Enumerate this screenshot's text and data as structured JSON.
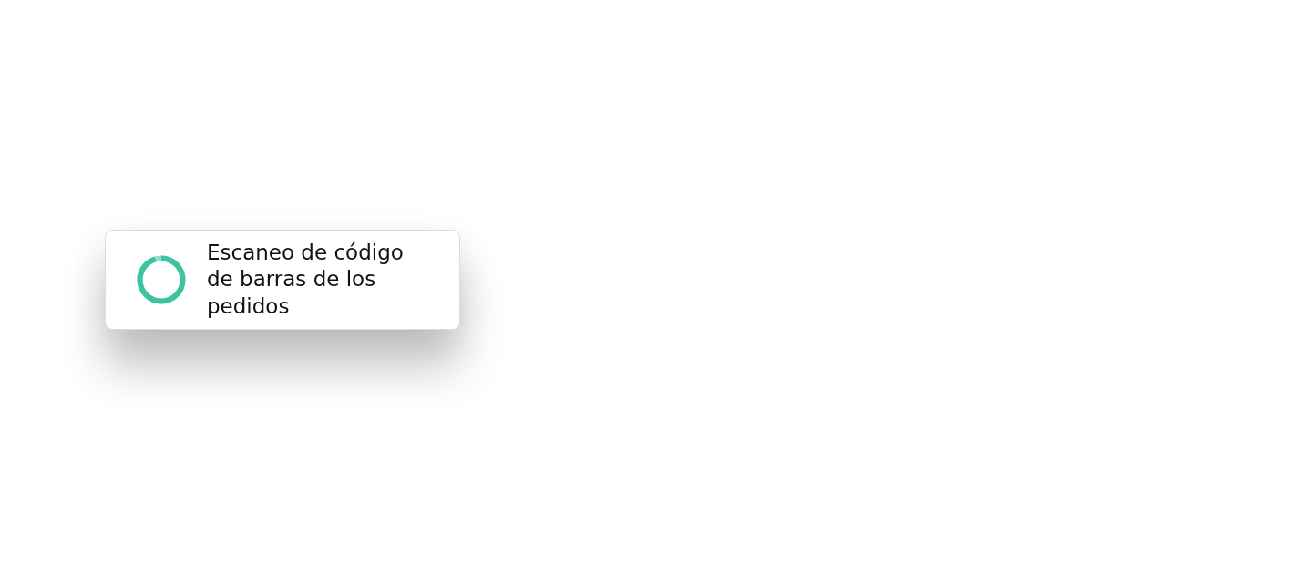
{
  "card": {
    "title": "Escaneo de código de barras de los pedidos"
  }
}
